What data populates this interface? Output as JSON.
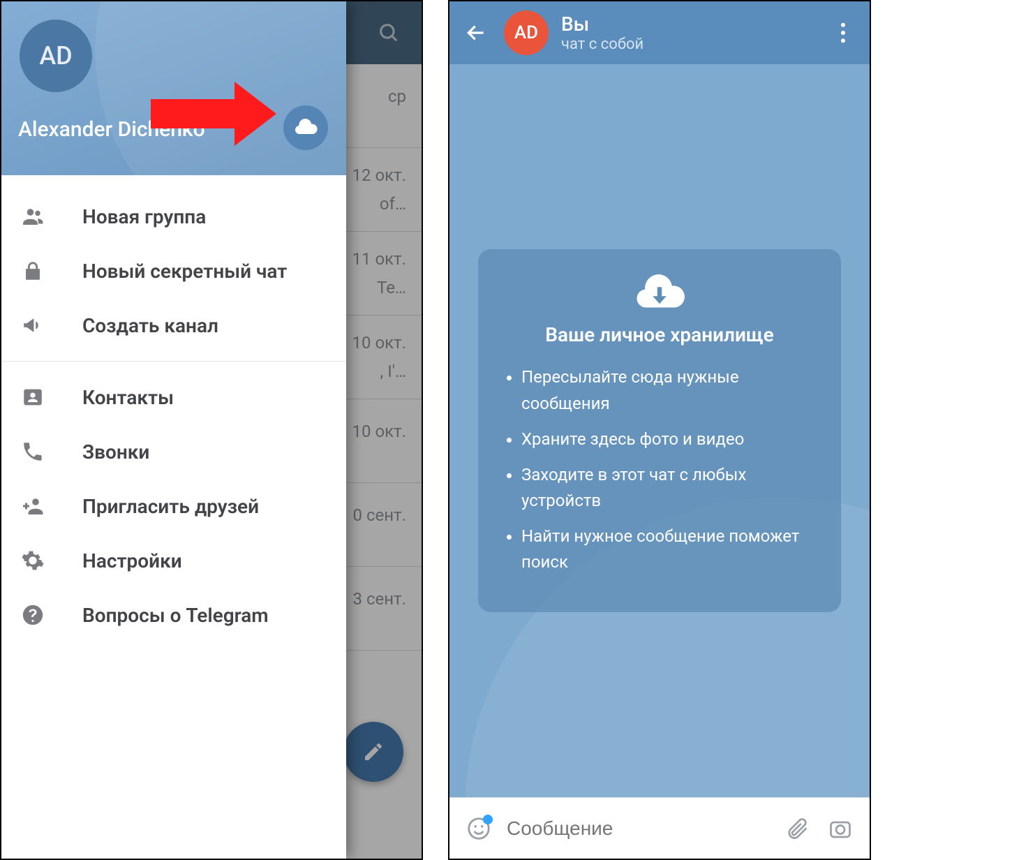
{
  "drawer": {
    "avatar_initials": "AD",
    "user_name": "Alexander Dichenko",
    "menu": {
      "new_group": "Новая группа",
      "secret_chat": "Новый секретный чат",
      "new_channel": "Создать канал",
      "contacts": "Контакты",
      "calls": "Звонки",
      "invite": "Пригласить друзей",
      "settings": "Настройки",
      "faq": "Вопросы о Telegram"
    }
  },
  "chatlist": {
    "dates": [
      "ср",
      "12 окт.",
      "11 окт.",
      "10 окт.",
      "10 окт.",
      "0 сент.",
      "3 сент."
    ],
    "snippets": [
      "",
      "of…",
      "Те…",
      ", I'…",
      "",
      "",
      ""
    ]
  },
  "saved": {
    "avatar_initials": "AD",
    "title": "Вы",
    "subtitle": "чат с собой",
    "card_title": "Ваше личное хранилище",
    "bullets": [
      "Пересылайте сюда нужные сообщения",
      "Храните здесь фото и видео",
      "Заходите в этот чат с любых устройств",
      "Найти нужное сообщение поможет поиск"
    ],
    "compose_placeholder": "Сообщение"
  }
}
